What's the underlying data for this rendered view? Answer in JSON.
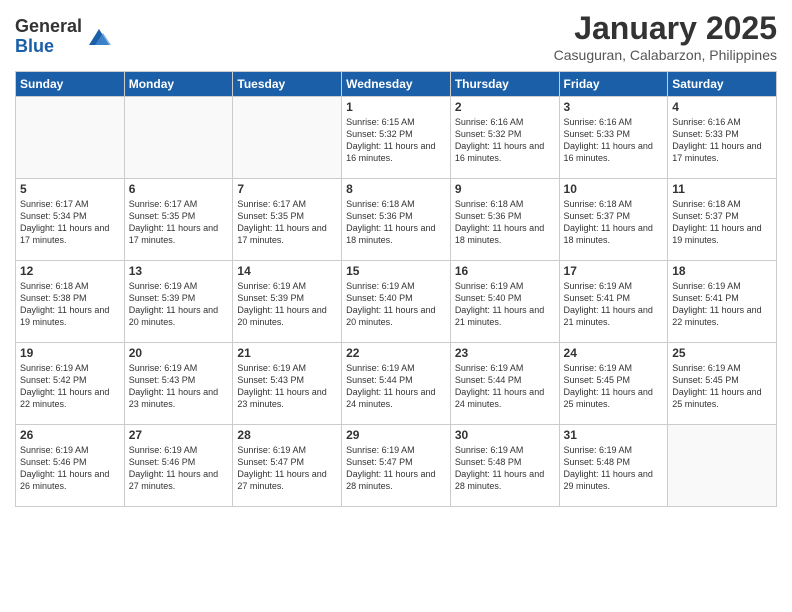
{
  "logo": {
    "general": "General",
    "blue": "Blue"
  },
  "header": {
    "month": "January 2025",
    "location": "Casuguran, Calabarzon, Philippines"
  },
  "weekdays": [
    "Sunday",
    "Monday",
    "Tuesday",
    "Wednesday",
    "Thursday",
    "Friday",
    "Saturday"
  ],
  "weeks": [
    [
      {
        "day": "",
        "sunrise": "",
        "sunset": "",
        "daylight": ""
      },
      {
        "day": "",
        "sunrise": "",
        "sunset": "",
        "daylight": ""
      },
      {
        "day": "",
        "sunrise": "",
        "sunset": "",
        "daylight": ""
      },
      {
        "day": "1",
        "sunrise": "Sunrise: 6:15 AM",
        "sunset": "Sunset: 5:32 PM",
        "daylight": "Daylight: 11 hours and 16 minutes."
      },
      {
        "day": "2",
        "sunrise": "Sunrise: 6:16 AM",
        "sunset": "Sunset: 5:32 PM",
        "daylight": "Daylight: 11 hours and 16 minutes."
      },
      {
        "day": "3",
        "sunrise": "Sunrise: 6:16 AM",
        "sunset": "Sunset: 5:33 PM",
        "daylight": "Daylight: 11 hours and 16 minutes."
      },
      {
        "day": "4",
        "sunrise": "Sunrise: 6:16 AM",
        "sunset": "Sunset: 5:33 PM",
        "daylight": "Daylight: 11 hours and 17 minutes."
      }
    ],
    [
      {
        "day": "5",
        "sunrise": "Sunrise: 6:17 AM",
        "sunset": "Sunset: 5:34 PM",
        "daylight": "Daylight: 11 hours and 17 minutes."
      },
      {
        "day": "6",
        "sunrise": "Sunrise: 6:17 AM",
        "sunset": "Sunset: 5:35 PM",
        "daylight": "Daylight: 11 hours and 17 minutes."
      },
      {
        "day": "7",
        "sunrise": "Sunrise: 6:17 AM",
        "sunset": "Sunset: 5:35 PM",
        "daylight": "Daylight: 11 hours and 17 minutes."
      },
      {
        "day": "8",
        "sunrise": "Sunrise: 6:18 AM",
        "sunset": "Sunset: 5:36 PM",
        "daylight": "Daylight: 11 hours and 18 minutes."
      },
      {
        "day": "9",
        "sunrise": "Sunrise: 6:18 AM",
        "sunset": "Sunset: 5:36 PM",
        "daylight": "Daylight: 11 hours and 18 minutes."
      },
      {
        "day": "10",
        "sunrise": "Sunrise: 6:18 AM",
        "sunset": "Sunset: 5:37 PM",
        "daylight": "Daylight: 11 hours and 18 minutes."
      },
      {
        "day": "11",
        "sunrise": "Sunrise: 6:18 AM",
        "sunset": "Sunset: 5:37 PM",
        "daylight": "Daylight: 11 hours and 19 minutes."
      }
    ],
    [
      {
        "day": "12",
        "sunrise": "Sunrise: 6:18 AM",
        "sunset": "Sunset: 5:38 PM",
        "daylight": "Daylight: 11 hours and 19 minutes."
      },
      {
        "day": "13",
        "sunrise": "Sunrise: 6:19 AM",
        "sunset": "Sunset: 5:39 PM",
        "daylight": "Daylight: 11 hours and 20 minutes."
      },
      {
        "day": "14",
        "sunrise": "Sunrise: 6:19 AM",
        "sunset": "Sunset: 5:39 PM",
        "daylight": "Daylight: 11 hours and 20 minutes."
      },
      {
        "day": "15",
        "sunrise": "Sunrise: 6:19 AM",
        "sunset": "Sunset: 5:40 PM",
        "daylight": "Daylight: 11 hours and 20 minutes."
      },
      {
        "day": "16",
        "sunrise": "Sunrise: 6:19 AM",
        "sunset": "Sunset: 5:40 PM",
        "daylight": "Daylight: 11 hours and 21 minutes."
      },
      {
        "day": "17",
        "sunrise": "Sunrise: 6:19 AM",
        "sunset": "Sunset: 5:41 PM",
        "daylight": "Daylight: 11 hours and 21 minutes."
      },
      {
        "day": "18",
        "sunrise": "Sunrise: 6:19 AM",
        "sunset": "Sunset: 5:41 PM",
        "daylight": "Daylight: 11 hours and 22 minutes."
      }
    ],
    [
      {
        "day": "19",
        "sunrise": "Sunrise: 6:19 AM",
        "sunset": "Sunset: 5:42 PM",
        "daylight": "Daylight: 11 hours and 22 minutes."
      },
      {
        "day": "20",
        "sunrise": "Sunrise: 6:19 AM",
        "sunset": "Sunset: 5:43 PM",
        "daylight": "Daylight: 11 hours and 23 minutes."
      },
      {
        "day": "21",
        "sunrise": "Sunrise: 6:19 AM",
        "sunset": "Sunset: 5:43 PM",
        "daylight": "Daylight: 11 hours and 23 minutes."
      },
      {
        "day": "22",
        "sunrise": "Sunrise: 6:19 AM",
        "sunset": "Sunset: 5:44 PM",
        "daylight": "Daylight: 11 hours and 24 minutes."
      },
      {
        "day": "23",
        "sunrise": "Sunrise: 6:19 AM",
        "sunset": "Sunset: 5:44 PM",
        "daylight": "Daylight: 11 hours and 24 minutes."
      },
      {
        "day": "24",
        "sunrise": "Sunrise: 6:19 AM",
        "sunset": "Sunset: 5:45 PM",
        "daylight": "Daylight: 11 hours and 25 minutes."
      },
      {
        "day": "25",
        "sunrise": "Sunrise: 6:19 AM",
        "sunset": "Sunset: 5:45 PM",
        "daylight": "Daylight: 11 hours and 25 minutes."
      }
    ],
    [
      {
        "day": "26",
        "sunrise": "Sunrise: 6:19 AM",
        "sunset": "Sunset: 5:46 PM",
        "daylight": "Daylight: 11 hours and 26 minutes."
      },
      {
        "day": "27",
        "sunrise": "Sunrise: 6:19 AM",
        "sunset": "Sunset: 5:46 PM",
        "daylight": "Daylight: 11 hours and 27 minutes."
      },
      {
        "day": "28",
        "sunrise": "Sunrise: 6:19 AM",
        "sunset": "Sunset: 5:47 PM",
        "daylight": "Daylight: 11 hours and 27 minutes."
      },
      {
        "day": "29",
        "sunrise": "Sunrise: 6:19 AM",
        "sunset": "Sunset: 5:47 PM",
        "daylight": "Daylight: 11 hours and 28 minutes."
      },
      {
        "day": "30",
        "sunrise": "Sunrise: 6:19 AM",
        "sunset": "Sunset: 5:48 PM",
        "daylight": "Daylight: 11 hours and 28 minutes."
      },
      {
        "day": "31",
        "sunrise": "Sunrise: 6:19 AM",
        "sunset": "Sunset: 5:48 PM",
        "daylight": "Daylight: 11 hours and 29 minutes."
      },
      {
        "day": "",
        "sunrise": "",
        "sunset": "",
        "daylight": ""
      }
    ]
  ]
}
